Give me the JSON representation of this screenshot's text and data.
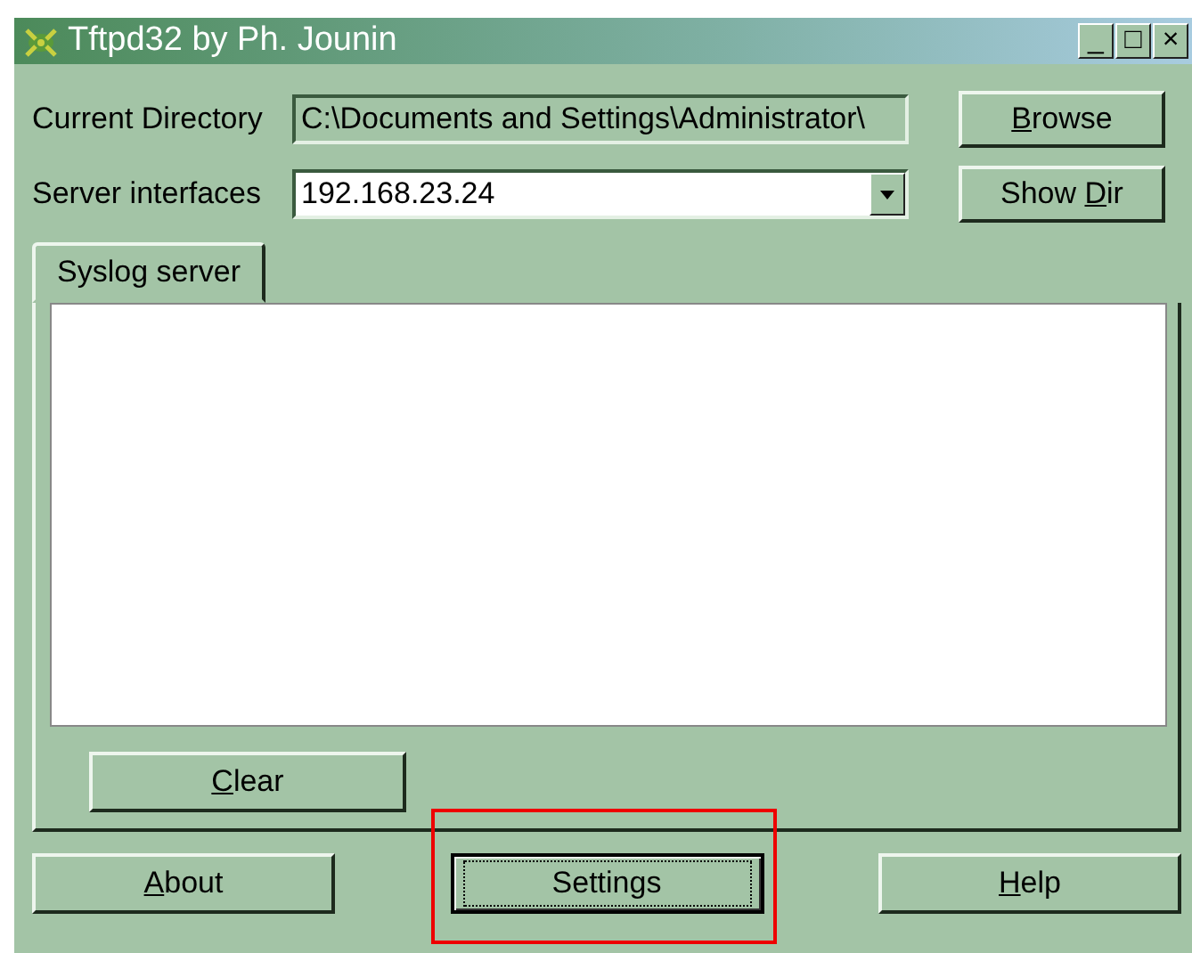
{
  "window": {
    "title": "Tftpd32 by Ph. Jounin",
    "controls": [
      "_",
      "□",
      "×"
    ]
  },
  "fields": [
    {
      "label": "Current Directory",
      "value": "C:\\Documents and Settings\\Administrator\\",
      "kind": "text",
      "button": {
        "accel_key": "B",
        "text_after": "rowse"
      }
    },
    {
      "label": "Server interfaces",
      "value": "192.168.23.24",
      "kind": "dropdown",
      "button": {
        "text_before": "Show ",
        "accel_key": "D",
        "text_after": "ir"
      }
    }
  ],
  "tabs": [
    {
      "label": "Syslog server",
      "selected": true
    }
  ],
  "clear_button": {
    "accel_key": "C",
    "text_after": "lear"
  },
  "buttons": [
    {
      "accel_key": "A",
      "text_after": "bout",
      "focused": false,
      "highlighted": false
    },
    {
      "text_before": "Settings",
      "focused": true,
      "highlighted": true
    },
    {
      "accel_key": "H",
      "text_after": "elp",
      "focused": false,
      "highlighted": false
    }
  ]
}
